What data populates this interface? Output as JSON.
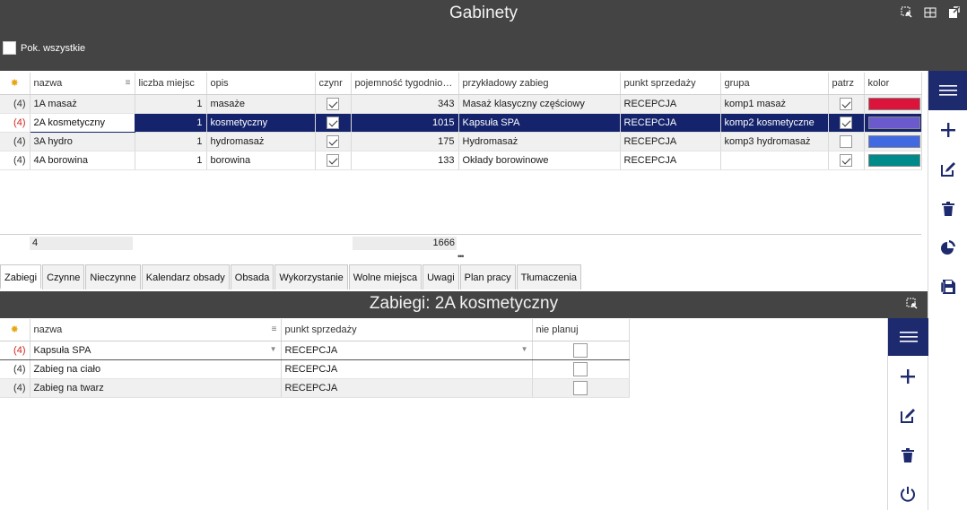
{
  "window": {
    "title": "Gabinety"
  },
  "filter": {
    "show_all_label": "Pok. wszystkie",
    "show_all_checked": false
  },
  "grid": {
    "columns": [
      "nazwa",
      "liczba miejsc",
      "opis",
      "czynr",
      "pojemność tygodniowa",
      "przykładowy zabieg",
      "punkt sprzedaży",
      "grupa",
      "patrz",
      "kolor"
    ],
    "rows": [
      {
        "ind": "(4)",
        "nazwa": "1A masaż",
        "liczba": "1",
        "opis": "masaże",
        "czynny": true,
        "pojemnosc": "343",
        "zabieg": "Masaż klasyczny częściowy",
        "punkt": "RECEPCJA",
        "grupa": "komp1 masaż",
        "patrz": true,
        "kolor": "#dc143c"
      },
      {
        "ind": "(4)",
        "nazwa": "2A kosmetyczny",
        "liczba": "1",
        "opis": "kosmetyczny",
        "czynny": true,
        "pojemnosc": "1015",
        "zabieg": "Kapsuła SPA",
        "punkt": "RECEPCJA",
        "grupa": "komp2 kosmetyczne",
        "patrz": true,
        "kolor": "#6a5acd"
      },
      {
        "ind": "(4)",
        "nazwa": "3A hydro",
        "liczba": "1",
        "opis": "hydromasaż",
        "czynny": true,
        "pojemnosc": "175",
        "zabieg": "Hydromasaż",
        "punkt": "RECEPCJA",
        "grupa": "komp3 hydromasaż",
        "patrz": false,
        "kolor": "#4169e1"
      },
      {
        "ind": "(4)",
        "nazwa": "4A borowina",
        "liczba": "1",
        "opis": "borowina",
        "czynny": true,
        "pojemnosc": "133",
        "zabieg": "Okłady borowinowe",
        "punkt": "RECEPCJA",
        "grupa": "",
        "patrz": true,
        "kolor": "#008b8b"
      }
    ],
    "footer_count": "4",
    "footer_sum": "1666"
  },
  "tabs": [
    "Zabiegi",
    "Czynne",
    "Nieczynne",
    "Kalendarz obsady",
    "Obsada",
    "Wykorzystanie",
    "Wolne miejsca",
    "Uwagi",
    "Plan pracy",
    "Tłumaczenia"
  ],
  "subpanel": {
    "title": "Zabiegi: 2A kosmetyczny",
    "columns": [
      "nazwa",
      "punkt sprzedaży",
      "nie planuj"
    ],
    "rows": [
      {
        "ind": "(4)",
        "nazwa": "Kapsuła SPA",
        "punkt": "RECEPCJA",
        "nie_planuj": false
      },
      {
        "ind": "(4)",
        "nazwa": "Zabieg na ciało",
        "punkt": "RECEPCJA",
        "nie_planuj": false
      },
      {
        "ind": "(4)",
        "nazwa": "Zabieg na twarz",
        "punkt": "RECEPCJA",
        "nie_planuj": false
      }
    ]
  },
  "icons": {
    "top": [
      "select-icon",
      "layout-icon",
      "export-icon"
    ],
    "sidebar": [
      "menu-icon",
      "add-icon",
      "edit-icon",
      "delete-icon",
      "chart-icon",
      "save-icon"
    ],
    "sub_sidebar": [
      "menu-icon",
      "add-icon",
      "edit-icon",
      "delete-icon",
      "power-icon"
    ]
  },
  "colors": {
    "header_bg": "#444444",
    "accent": "#14236b",
    "sidebar_button": "#1e2a6e"
  }
}
